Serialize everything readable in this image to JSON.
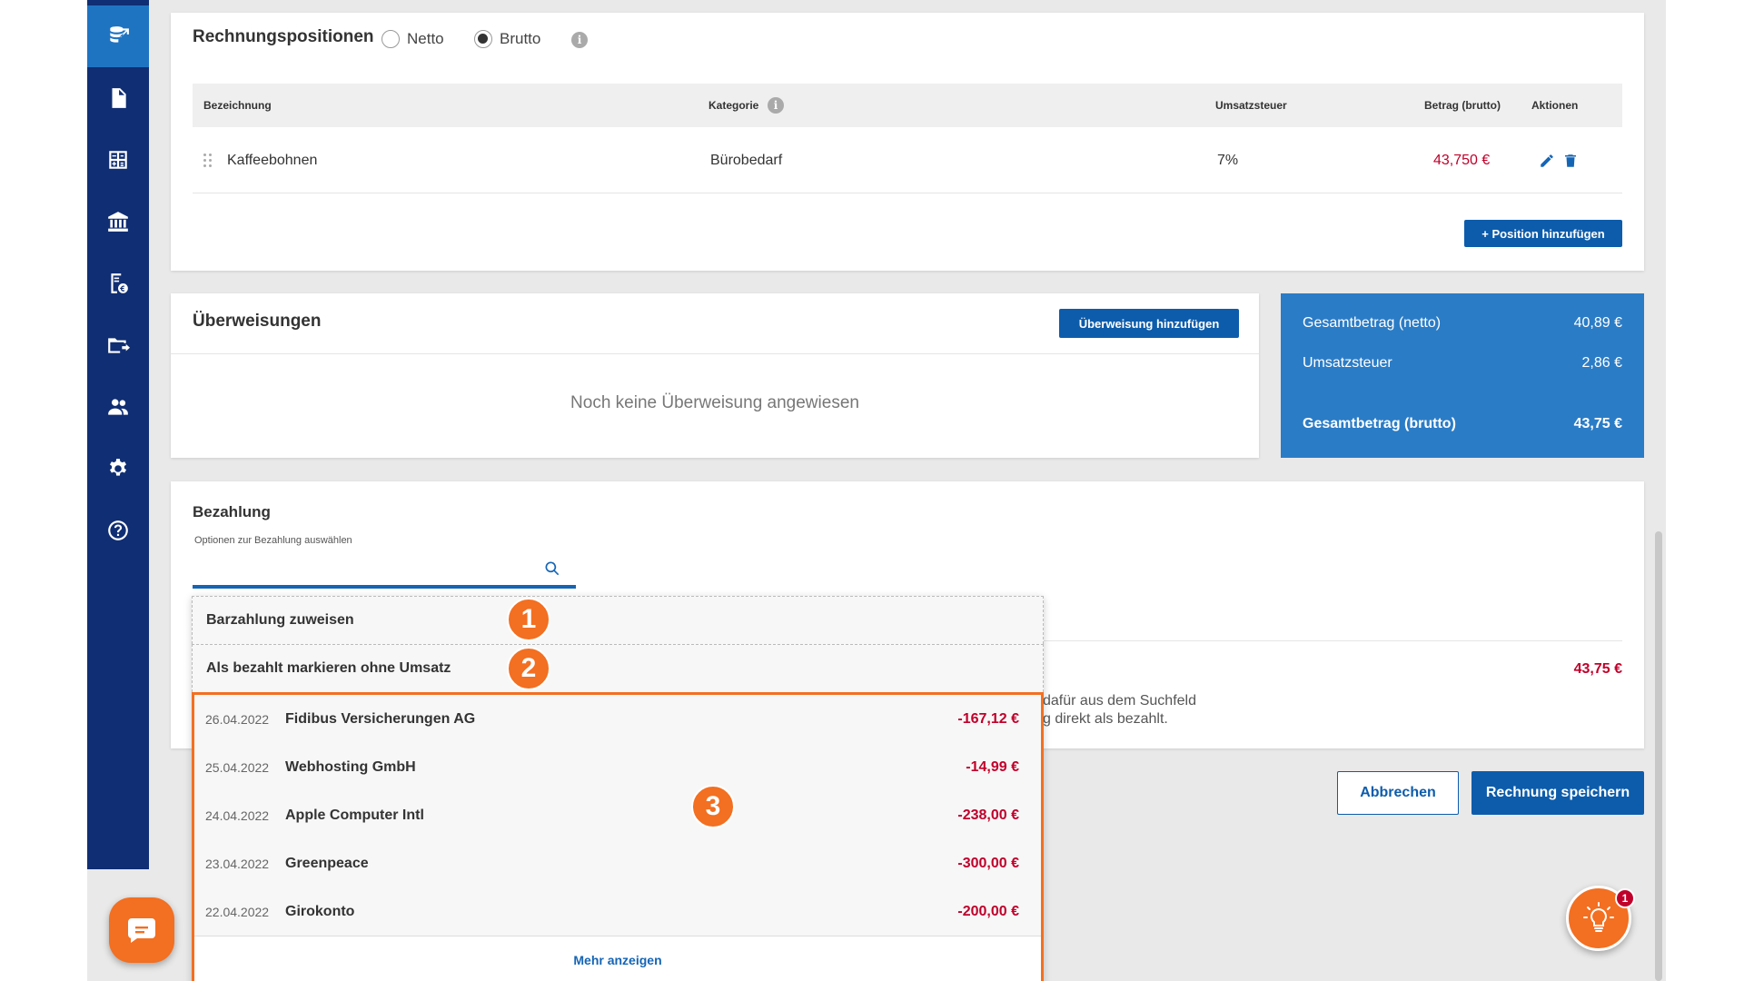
{
  "sidebar": {
    "items": [
      {
        "icon": "database-import-icon",
        "active": true
      },
      {
        "icon": "document-icon"
      },
      {
        "icon": "calculator-icon"
      },
      {
        "icon": "bank-icon"
      },
      {
        "icon": "receipt-euro-icon"
      },
      {
        "icon": "folder-export-icon"
      },
      {
        "icon": "users-icon"
      },
      {
        "icon": "gear-icon"
      },
      {
        "icon": "help-circle-icon"
      }
    ]
  },
  "positions": {
    "title": "Rechnungspositionen",
    "radio_netto": "Netto",
    "radio_brutto": "Brutto",
    "selected": "Brutto",
    "columns": {
      "bezeichnung": "Bezeichnung",
      "kategorie": "Kategorie",
      "umsatzsteuer": "Umsatzsteuer",
      "betrag": "Betrag (brutto)",
      "aktionen": "Aktionen"
    },
    "rows": [
      {
        "bezeichnung": "Kaffeebohnen",
        "kategorie": "Bürobedarf",
        "umsatzsteuer": "7%",
        "betrag": "43,750 €"
      }
    ],
    "add_button": "+ Position hinzufügen"
  },
  "transfers": {
    "title": "Überweisungen",
    "add_button": "Überweisung hinzufügen",
    "empty_text": "Noch keine Überweisung angewiesen"
  },
  "totals": {
    "netto_label": "Gesamtbetrag (netto)",
    "netto_value": "40,89 €",
    "tax_label": "Umsatzsteuer",
    "tax_value": "2,86 €",
    "brutto_label": "Gesamtbetrag (brutto)",
    "brutto_value": "43,75 €"
  },
  "payment": {
    "title": "Bezahlung",
    "field_label": "Optionen zur Bezahlung auswählen",
    "amount": "43,75 €",
    "hint_line1": "dafür aus dem Suchfeld",
    "hint_line2": "g direkt als bezahlt."
  },
  "dropdown": {
    "option_cash": "Barzahlung zuweisen",
    "option_mark_paid": "Als bezahlt markieren ohne Umsatz",
    "transactions": [
      {
        "date": "26.04.2022",
        "name": "Fidibus Versicherungen AG",
        "amount": "-167,12 €"
      },
      {
        "date": "25.04.2022",
        "name": "Webhosting GmbH",
        "amount": "-14,99 €"
      },
      {
        "date": "24.04.2022",
        "name": "Apple Computer Intl",
        "amount": "-238,00 €"
      },
      {
        "date": "23.04.2022",
        "name": "Greenpeace",
        "amount": "-300,00 €"
      },
      {
        "date": "22.04.2022",
        "name": "Girokonto",
        "amount": "-200,00 €"
      }
    ],
    "more": "Mehr anzeigen"
  },
  "badges": {
    "one": "1",
    "two": "2",
    "three": "3"
  },
  "actions": {
    "cancel": "Abbrechen",
    "save": "Rechnung speichern"
  },
  "tips": {
    "count": "1"
  },
  "colors": {
    "sidebar": "#102e73",
    "accent": "#0d5cab",
    "highlight": "#f36f21",
    "negative": "#c0002a"
  }
}
